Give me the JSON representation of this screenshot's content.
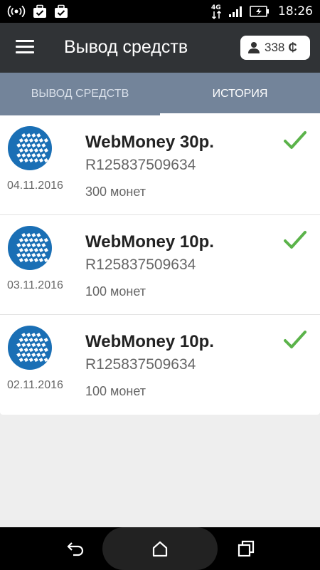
{
  "status_bar": {
    "time": "18:26",
    "network": "4G",
    "icons": [
      "wifi-hotspot-icon",
      "briefcase-check-icon",
      "briefcase-check-icon",
      "signal-icon",
      "battery-charging-icon"
    ]
  },
  "app_bar": {
    "title": "Вывод средств",
    "balance": "338",
    "currency_symbol": "₵"
  },
  "tabs": [
    {
      "label": "ВЫВОД СРЕДСТВ",
      "active": false
    },
    {
      "label": "ИСТОРИЯ",
      "active": true
    }
  ],
  "history": [
    {
      "title": "WebMoney 30р.",
      "account": "R125837509634",
      "coins": "300 монет",
      "date": "04.11.2016",
      "status": "check-icon"
    },
    {
      "title": "WebMoney 10р.",
      "account": "R125837509634",
      "coins": "100 монет",
      "date": "03.11.2016",
      "status": "check-icon"
    },
    {
      "title": "WebMoney 10р.",
      "account": "R125837509634",
      "coins": "100 монет",
      "date": "02.11.2016",
      "status": "check-icon"
    }
  ],
  "colors": {
    "app_bar": "#303336",
    "tabs": "#73849a",
    "webmoney_blue": "#1a6fb5",
    "check_green": "#5bb34a"
  }
}
